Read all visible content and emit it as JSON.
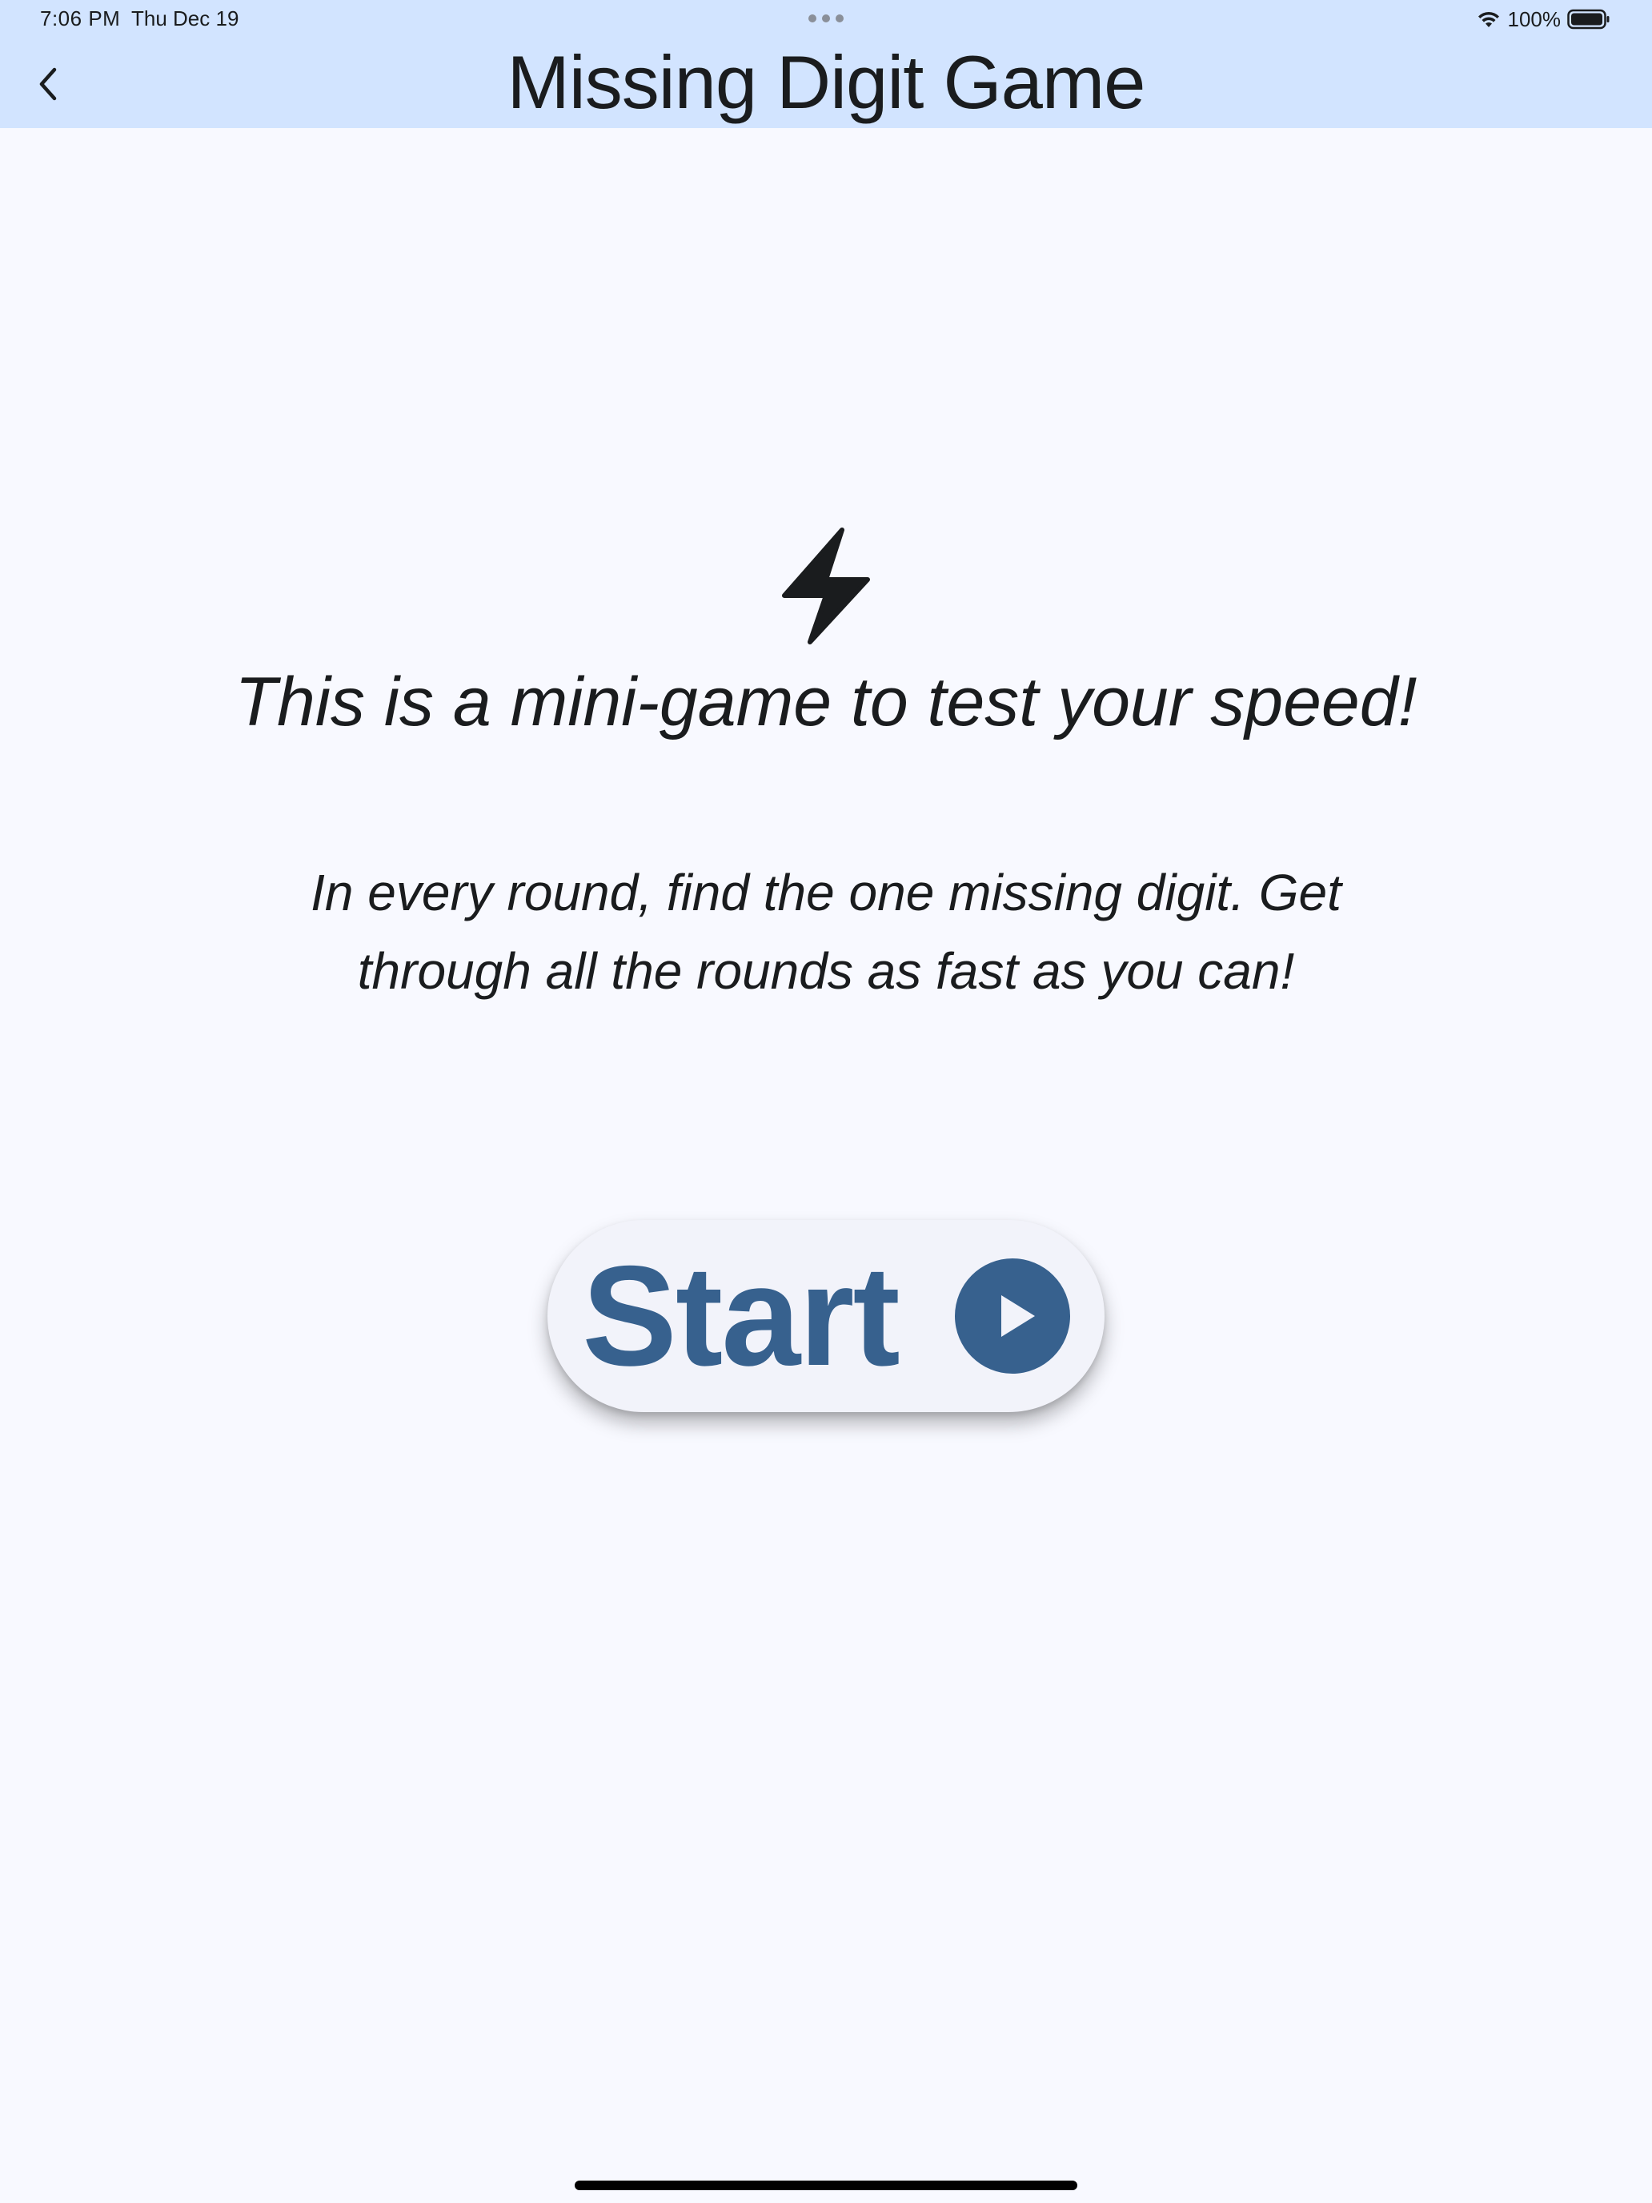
{
  "status_bar": {
    "time": "7:06 PM",
    "date": "Thu Dec 19",
    "battery": "100%"
  },
  "app_bar": {
    "title": "Missing Digit Game",
    "back_icon": "chevron-left-icon"
  },
  "intro": {
    "icon": "lightning-bolt-icon",
    "headline": "This is a mini-game to test your speed!",
    "description": "In every round, find the one missing digit. Get through all the rounds as fast as you can!"
  },
  "start_button": {
    "label": "Start",
    "icon": "play-circle-icon"
  },
  "colors": {
    "app_bar_bg": "#d2e4ff",
    "background": "#f8f9ff",
    "primary": "#37618e",
    "text": "#1a1c1e"
  }
}
